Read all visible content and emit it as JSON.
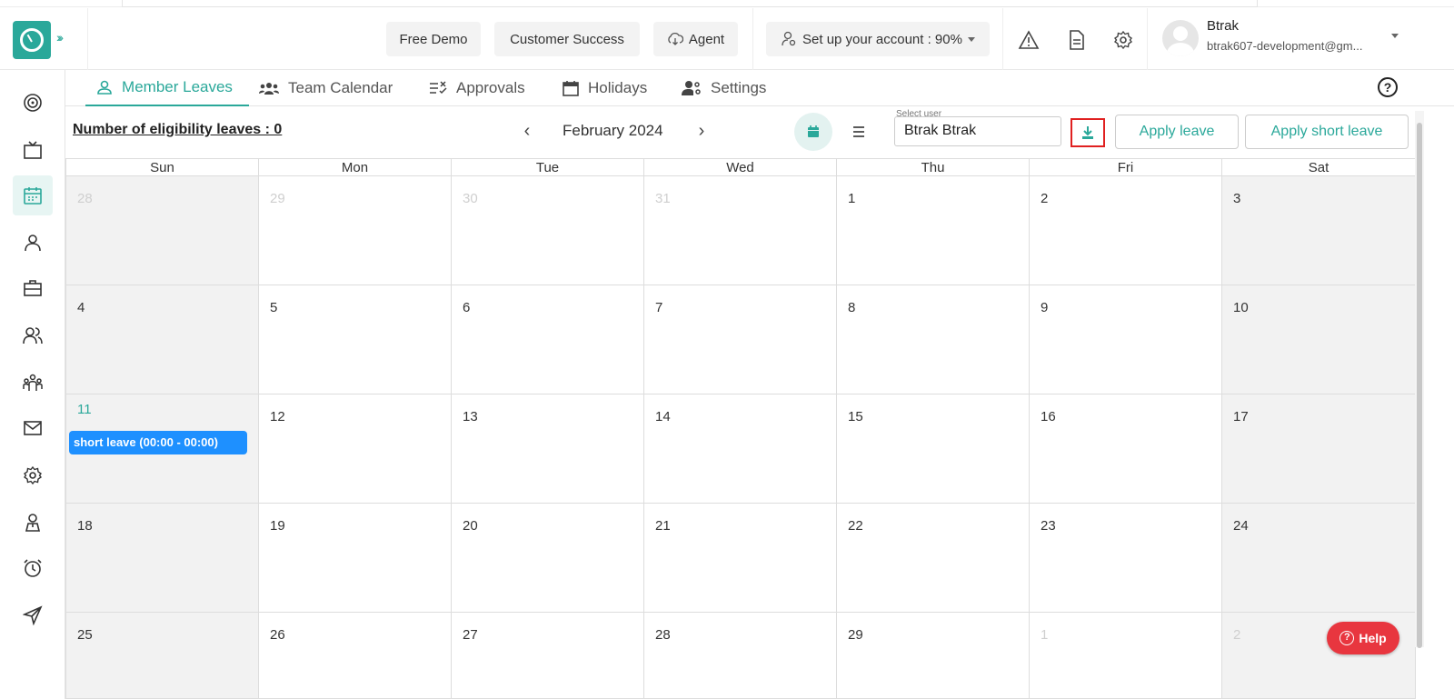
{
  "header": {
    "free_demo": "Free Demo",
    "customer_success": "Customer Success",
    "agent": "Agent",
    "setup": "Set up your account : 90%",
    "user_name": "Btrak",
    "user_email": "btrak607-development@gm..."
  },
  "tabs": [
    {
      "label": "Member Leaves",
      "active": true
    },
    {
      "label": "Team Calendar"
    },
    {
      "label": "Approvals"
    },
    {
      "label": "Holidays"
    },
    {
      "label": "Settings"
    }
  ],
  "toolbar": {
    "eligibility": "Number of eligibility leaves : 0",
    "month": "February 2024",
    "select_user_label": "Select user",
    "selected_user": "Btrak Btrak",
    "apply_leave": "Apply leave",
    "apply_short_leave": "Apply short leave"
  },
  "calendar": {
    "days": [
      "Sun",
      "Mon",
      "Tue",
      "Wed",
      "Thu",
      "Fri",
      "Sat"
    ],
    "weeks": [
      [
        "28",
        "29",
        "30",
        "31",
        "1",
        "2",
        "3"
      ],
      [
        "4",
        "5",
        "6",
        "7",
        "8",
        "9",
        "10"
      ],
      [
        "11",
        "12",
        "13",
        "14",
        "15",
        "16",
        "17"
      ],
      [
        "18",
        "19",
        "20",
        "21",
        "22",
        "23",
        "24"
      ],
      [
        "25",
        "26",
        "27",
        "28",
        "29",
        "1",
        "2"
      ]
    ],
    "event": "short leave (00:00 - 00:00)"
  },
  "help": "Help",
  "colors": {
    "accent": "#2aa89a",
    "event": "#1e90ff",
    "help": "#e8363f"
  }
}
